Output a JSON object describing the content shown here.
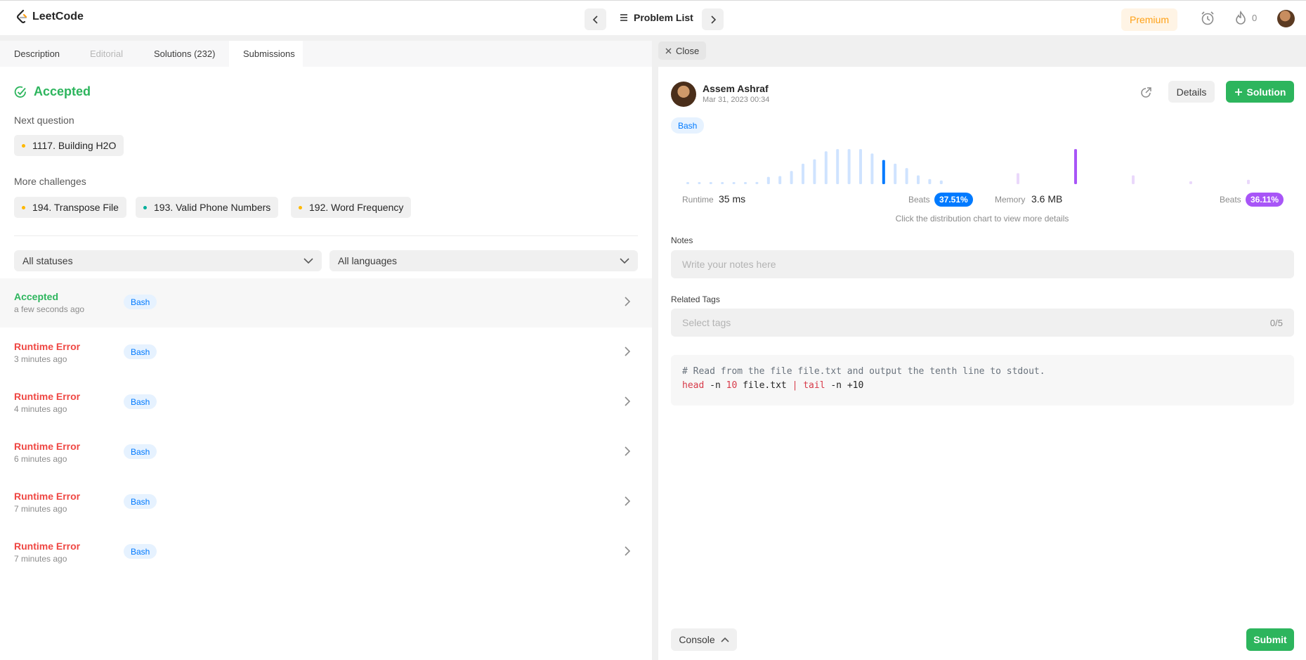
{
  "header": {
    "logo_text": "LeetCode",
    "problem_list_label": "Problem List",
    "premium_label": "Premium",
    "streak_count": "0"
  },
  "left": {
    "tabs": [
      {
        "label": "Description",
        "state": "normal"
      },
      {
        "label": "Editorial",
        "state": "disabled"
      },
      {
        "label": "Solutions (232)",
        "state": "normal"
      },
      {
        "label": "Submissions",
        "state": "active"
      }
    ],
    "status_title": "Accepted",
    "next_question_label": "Next question",
    "next_question": {
      "label": "1117. Building H2O",
      "dot_color": "#ffb800"
    },
    "more_challenges_label": "More challenges",
    "challenges": [
      {
        "label": "194. Transpose File",
        "dot_color": "#ffb800"
      },
      {
        "label": "193. Valid Phone Numbers",
        "dot_color": "#00af9b"
      },
      {
        "label": "192. Word Frequency",
        "dot_color": "#ffb800"
      }
    ],
    "status_filter": "All statuses",
    "language_filter": "All languages",
    "submissions": [
      {
        "status": "Accepted",
        "time": "a few seconds ago",
        "lang": "Bash",
        "color": "#2db55d"
      },
      {
        "status": "Runtime Error",
        "time": "3 minutes ago",
        "lang": "Bash",
        "color": "#ef4743"
      },
      {
        "status": "Runtime Error",
        "time": "4 minutes ago",
        "lang": "Bash",
        "color": "#ef4743"
      },
      {
        "status": "Runtime Error",
        "time": "6 minutes ago",
        "lang": "Bash",
        "color": "#ef4743"
      },
      {
        "status": "Runtime Error",
        "time": "7 minutes ago",
        "lang": "Bash",
        "color": "#ef4743"
      },
      {
        "status": "Runtime Error",
        "time": "7 minutes ago",
        "lang": "Bash",
        "color": "#ef4743"
      }
    ]
  },
  "right": {
    "close_label": "Close",
    "user_name": "Assem Ashraf",
    "submitted_at": "Mar 31, 2023 00:34",
    "details_label": "Details",
    "solution_label": "Solution",
    "language": "Bash",
    "runtime_label": "Runtime",
    "runtime_value": "35 ms",
    "runtime_beats_label": "Beats",
    "runtime_beats": "37.51%",
    "memory_label": "Memory",
    "memory_value": "3.6 MB",
    "memory_beats_label": "Beats",
    "memory_beats": "36.11%",
    "chart_hint": "Click the distribution chart to view more details",
    "notes_label": "Notes",
    "notes_placeholder": "Write your notes here",
    "tags_label": "Related Tags",
    "tags_placeholder": "Select tags",
    "tags_count": "0/5",
    "code_line1": "# Read from the file file.txt and output the tenth line to stdout.",
    "code_line2_cmd1": "head",
    "code_line2_args1": " -n ",
    "code_line2_num": "10",
    "code_line2_file": " file.txt ",
    "code_line2_pipe": "|",
    "code_line2_cmd2": " tail",
    "code_line2_args2": " -n +10",
    "console_label": "Console",
    "submit_label": "Submit",
    "colors": {
      "runtime": "#007aff",
      "memory": "#a855f7",
      "accent": "#2db55d"
    }
  },
  "chart_data": [
    {
      "type": "bar",
      "title": "",
      "x": [],
      "values": [
        0.04,
        0.04,
        0.04,
        0.04,
        0.04,
        0.04,
        0.06,
        0.2,
        0.22,
        0.36,
        0.56,
        0.68,
        0.9,
        0.96,
        0.96,
        0.96,
        0.84,
        0.66,
        0.56,
        0.44,
        0.24,
        0.14,
        0.1
      ],
      "highlight_index": 17,
      "ylim": [
        0,
        1
      ]
    },
    {
      "type": "bar",
      "title": "",
      "x": [],
      "values": [
        0.3,
        0.96,
        0.24,
        0.08,
        0.12
      ],
      "highlight_index": 1,
      "ylim": [
        0,
        1
      ]
    }
  ]
}
